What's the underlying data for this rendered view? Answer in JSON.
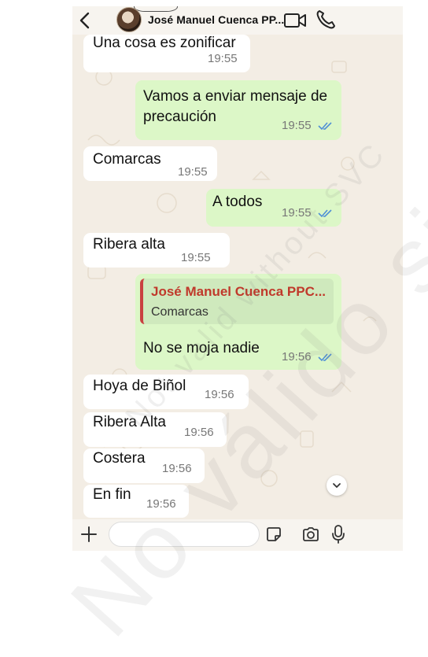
{
  "header": {
    "contact_name": "José Manuel Cuenca PP..."
  },
  "messages": [
    {
      "direction": "in",
      "text": "Una cosa es zonificar",
      "time": "19:55"
    },
    {
      "direction": "out",
      "lines": [
        "Vamos a enviar mensaje de",
        "precaución"
      ],
      "time": "19:55",
      "ticks": "read"
    },
    {
      "direction": "in",
      "text": "Comarcas",
      "time": "19:55"
    },
    {
      "direction": "out",
      "text": "A todos",
      "time": "19:55",
      "ticks": "read"
    },
    {
      "direction": "in",
      "text": "Ribera alta",
      "time": "19:55"
    },
    {
      "direction": "out",
      "quote_author": "José Manuel Cuenca PPC...",
      "quote_text": "Comarcas",
      "text": "No se moja nadie",
      "time": "19:56",
      "ticks": "read"
    },
    {
      "direction": "in",
      "text": "Hoya de Biñol",
      "time": "19:56"
    },
    {
      "direction": "in",
      "text": "Ribera Alta",
      "time": "19:56"
    },
    {
      "direction": "in",
      "text": "Costera",
      "time": "19:56"
    },
    {
      "direction": "in",
      "text": "En fin",
      "time": "19:56"
    }
  ],
  "watermark": {
    "line1": "No válido sin CSV",
    "line2": "Not valid without SVC"
  },
  "icons": {
    "back": "chevron-left-icon",
    "video": "video-camera-icon",
    "call": "phone-icon",
    "scroll": "chevron-down-icon",
    "plus": "plus-icon",
    "sticker": "sticker-icon",
    "camera": "camera-icon",
    "mic": "microphone-icon"
  },
  "colors": {
    "outgoing_bubble": "#dcf7c7",
    "incoming_bubble": "#ffffff",
    "read_ticks": "#4f8fd6",
    "quote_author": "#c0392b",
    "chat_background": "#f3ede4"
  }
}
